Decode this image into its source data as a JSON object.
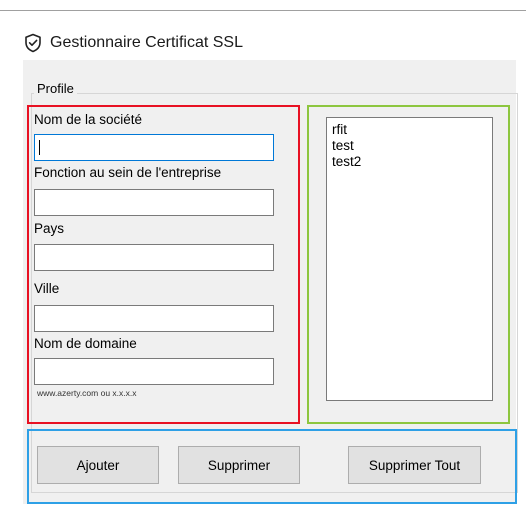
{
  "window": {
    "title": "Gestionnaire Certificat SSL",
    "icon": "shield-check-icon"
  },
  "profile": {
    "group_label": "Profile",
    "fields": {
      "company": {
        "label": "Nom de la société",
        "value": ""
      },
      "function": {
        "label": "Fonction au sein de l'entreprise",
        "value": ""
      },
      "country": {
        "label": "Pays",
        "value": ""
      },
      "city": {
        "label": "Ville",
        "value": ""
      },
      "domain": {
        "label": "Nom de domaine",
        "value": "",
        "hint": "www.azerty.com ou x.x.x.x"
      }
    }
  },
  "list": {
    "items": [
      "rfit",
      "test",
      "test2"
    ]
  },
  "actions": {
    "add_label": "Ajouter",
    "delete_label": "Supprimer",
    "delete_all_label": "Supprimer Tout"
  },
  "colors": {
    "form_border": "#e81123",
    "list_border": "#8dc63f",
    "actions_border": "#2ea0e6",
    "focus_border": "#0078d7"
  }
}
